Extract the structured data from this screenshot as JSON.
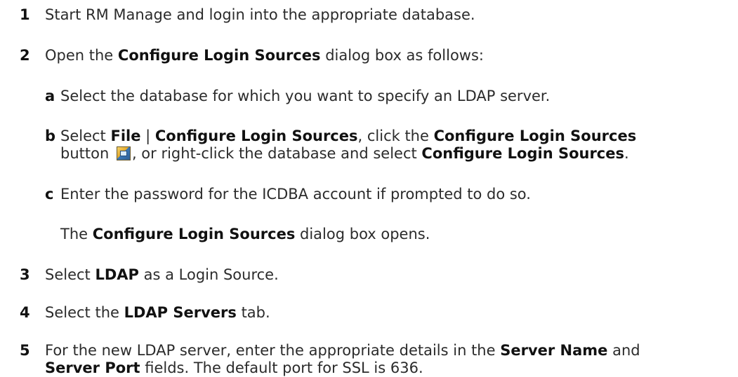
{
  "steps": [
    {
      "num": "1",
      "text": "Start RM Manage and login into the appropriate database."
    },
    {
      "num": "2",
      "pre": "Open the ",
      "bold": "Configure Login Sources",
      "post": " dialog box as follows:"
    },
    {
      "num": "3",
      "pre": "Select ",
      "bold": "LDAP",
      "post": " as a Login Source."
    },
    {
      "num": "4",
      "pre": "Select the ",
      "bold": "LDAP Servers",
      "post": " tab."
    },
    {
      "num": "5",
      "l1_pre": "For the new LDAP server, enter the appropriate details in the ",
      "l1_bold": "Server Name",
      "l1_post": " and",
      "l2_bold": "Server Port",
      "l2_post": " fields. The default port for SSL is 636."
    }
  ],
  "substeps": {
    "a": {
      "letter": "a",
      "text": "Select the database for which you want to specify an LDAP server."
    },
    "b": {
      "letter": "b",
      "t1": "Select ",
      "b1": "File",
      "t2": " | ",
      "b2": "Configure Login Sources",
      "t3": ", click the ",
      "b3": "Configure Login Sources",
      "t4": "button ",
      "t5": ", or right-click the database and select ",
      "b4": "Configure Login Sources",
      "t6": "."
    },
    "c": {
      "letter": "c",
      "text": "Enter the password for the ICDBA account if prompted to do so."
    }
  },
  "note": {
    "pre": "The ",
    "bold": "Configure Login Sources",
    "post": " dialog box opens."
  },
  "icons": {
    "configure_button": "configure-login-sources-icon"
  }
}
